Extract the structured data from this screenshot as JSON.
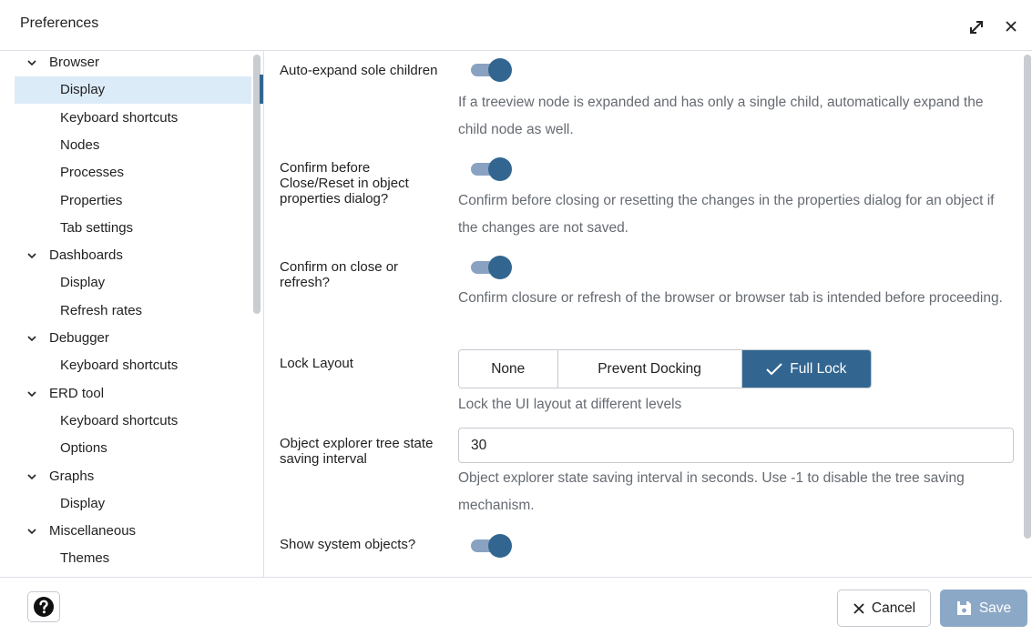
{
  "dialog": {
    "title": "Preferences"
  },
  "tree": {
    "items": [
      {
        "label": "Browser",
        "kind": "group"
      },
      {
        "label": "Display",
        "kind": "child",
        "selected": true
      },
      {
        "label": "Keyboard shortcuts",
        "kind": "child"
      },
      {
        "label": "Nodes",
        "kind": "child"
      },
      {
        "label": "Processes",
        "kind": "child"
      },
      {
        "label": "Properties",
        "kind": "child"
      },
      {
        "label": "Tab settings",
        "kind": "child"
      },
      {
        "label": "Dashboards",
        "kind": "group"
      },
      {
        "label": "Display",
        "kind": "child"
      },
      {
        "label": "Refresh rates",
        "kind": "child"
      },
      {
        "label": "Debugger",
        "kind": "group"
      },
      {
        "label": "Keyboard shortcuts",
        "kind": "child"
      },
      {
        "label": "ERD tool",
        "kind": "group"
      },
      {
        "label": "Keyboard shortcuts",
        "kind": "child"
      },
      {
        "label": "Options",
        "kind": "child"
      },
      {
        "label": "Graphs",
        "kind": "group"
      },
      {
        "label": "Display",
        "kind": "child"
      },
      {
        "label": "Miscellaneous",
        "kind": "group"
      },
      {
        "label": "Themes",
        "kind": "child"
      }
    ]
  },
  "settings": {
    "auto_expand": {
      "label": "Auto-expand sole children",
      "enabled": true,
      "help": "If a treeview node is expanded and has only a single child, automatically expand the child node as well."
    },
    "confirm_close_reset": {
      "label": "Confirm before Close/Reset in object properties dialog?",
      "enabled": true,
      "help": "Confirm before closing or resetting the changes in the properties dialog for an object if the changes are not saved."
    },
    "confirm_close_refresh": {
      "label": "Confirm on close or refresh?",
      "enabled": true,
      "help": "Confirm closure or refresh of the browser or browser tab is intended before proceeding."
    },
    "lock_layout": {
      "label": "Lock Layout",
      "options": [
        "None",
        "Prevent Docking",
        "Full Lock"
      ],
      "selected": "Full Lock",
      "help": "Lock the UI layout at different levels"
    },
    "tree_saving_interval": {
      "label": "Object explorer tree state saving interval",
      "value": "30",
      "help": "Object explorer state saving interval in seconds. Use -1 to disable the tree saving mechanism."
    },
    "show_system_objects": {
      "label": "Show system objects?",
      "enabled": true
    }
  },
  "footer": {
    "cancel_label": "Cancel",
    "save_label": "Save"
  },
  "icons": {
    "expand": "expand-icon",
    "close": "close-icon",
    "help": "help-icon",
    "cancel": "close-icon",
    "save": "floppy-disk-icon",
    "check": "check-icon",
    "chevron": "chevron-down-icon"
  },
  "colors": {
    "accent": "#326690",
    "selected_row": "#dcebf8",
    "save_disabled": "#8ba8c6",
    "help_text": "#666b72"
  }
}
